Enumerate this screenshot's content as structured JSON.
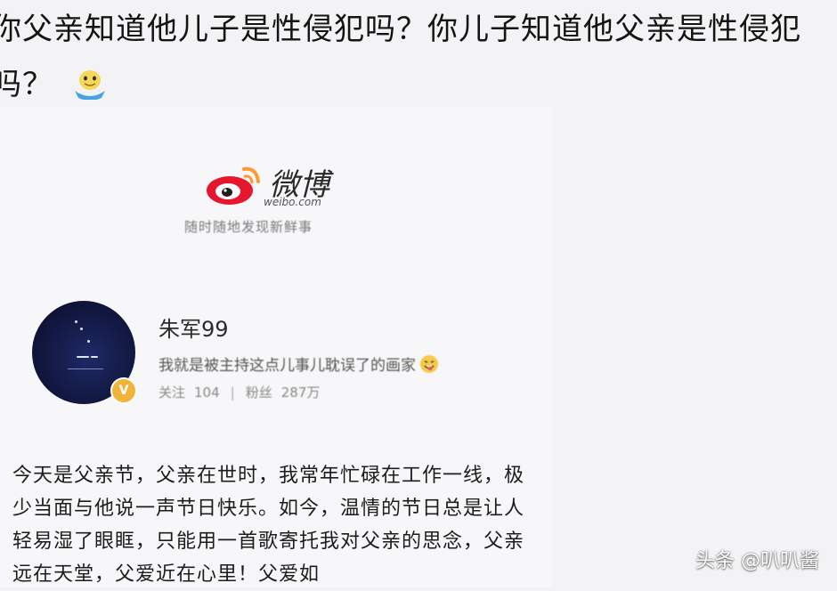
{
  "headline": {
    "text": "你父亲知道他儿子是性侵犯吗？你儿子知道他父亲是性侵犯吗？",
    "emoji_icon": "doge-emoji"
  },
  "weibo": {
    "brand_name": "微博",
    "url": "weibo.com",
    "slogan": "随时随地发现新鲜事",
    "logo_colors": {
      "red": "#e6162d",
      "orange": "#ff9933",
      "black": "#1e1e1e"
    }
  },
  "profile": {
    "username": "朱军99",
    "bio": "我就是被主持这点儿事儿耽误了的画家",
    "bio_emoji_icon": "grin-tongue-emoji",
    "following_label": "关注",
    "following_count": "104",
    "followers_label": "粉丝",
    "followers_count": "287万",
    "verified_badge_color": "#f0b43a"
  },
  "post": {
    "text": "今天是父亲节，父亲在世时，我常年忙碌在工作一线，极少当面与他说一声节日快乐。如今，温情的节日总是让人轻易湿了眼眶，只能用一首歌寄托我对父亲的思念，父亲远在天堂，父爱近在心里！父爱如"
  },
  "watermark": {
    "text": "头条 @叭叭酱"
  }
}
